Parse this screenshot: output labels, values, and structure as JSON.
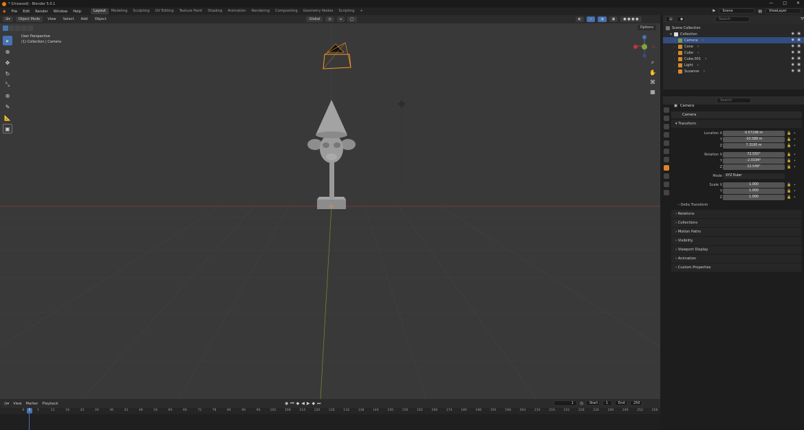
{
  "titlebar": {
    "title": "* (Unsaved) - Blender 5.0.1",
    "minimize": "—",
    "maximize": "□",
    "close": "✕"
  },
  "menu": [
    "File",
    "Edit",
    "Render",
    "Window",
    "Help"
  ],
  "workspaces": [
    "Layout",
    "Modeling",
    "Sculpting",
    "UV Editing",
    "Texture Paint",
    "Shading",
    "Animation",
    "Rendering",
    "Compositing",
    "Geometry Nodes",
    "Scripting"
  ],
  "workspace_add": "+",
  "scene": {
    "label": "Scene",
    "viewlayer": "ViewLayer"
  },
  "viewport_header": {
    "mode": "Object Mode",
    "view": "View",
    "select": "Select",
    "add": "Add",
    "object": "Object",
    "orientation": "Global",
    "options": "Options"
  },
  "viewport_info": {
    "perspective": "User Perspective",
    "context": "(1) Collection | Camera"
  },
  "timeline_header": {
    "view": "View",
    "marker": "Marker",
    "playback": "Playback",
    "current_frame": "1",
    "start_label": "Start",
    "start": "1",
    "end_label": "End",
    "end": "250"
  },
  "timeline_ticks": [
    "0",
    "1",
    "11",
    "18",
    "24",
    "30",
    "36",
    "42",
    "48",
    "54",
    "60",
    "66",
    "72",
    "78",
    "84",
    "90",
    "96",
    "102",
    "108",
    "114",
    "120",
    "126",
    "132",
    "138",
    "144",
    "150",
    "156",
    "162",
    "168",
    "174",
    "180",
    "186",
    "192",
    "198",
    "204",
    "210",
    "216",
    "222",
    "228",
    "234",
    "240",
    "246",
    "252",
    "258"
  ],
  "outliner": {
    "search_placeholder": "Search",
    "scene_collection": "Scene Collection",
    "collection": "Collection",
    "items": [
      {
        "name": "Camera",
        "color": "#7a9d4e"
      },
      {
        "name": "Cone",
        "color": "#d98a2b"
      },
      {
        "name": "Cube",
        "color": "#d98a2b"
      },
      {
        "name": "Cube.001",
        "color": "#d98a2b"
      },
      {
        "name": "Light",
        "color": "#d98a2b"
      },
      {
        "name": "Suzanne",
        "color": "#d98a2b"
      }
    ]
  },
  "properties": {
    "search_placeholder": "Search",
    "object": "Camera",
    "name": "Camera",
    "transform_label": "Transform",
    "location_label": "Location X",
    "rotation_label": "Rotation X",
    "mode_label": "Mode",
    "scale_label": "Scale X",
    "y_label": "Y",
    "z_label": "Z",
    "location": [
      "0.57198 m",
      "-10.588 m",
      "7.3195 m"
    ],
    "rotation": [
      "72.555°",
      "-2.0194°",
      "12.549°"
    ],
    "mode": "XYZ Euler",
    "scale": [
      "1.000",
      "1.000",
      "1.000"
    ],
    "delta": "Delta Transform",
    "panels": [
      "Relations",
      "Collections",
      "Motion Paths",
      "Visibility",
      "Viewport Display",
      "Animation",
      "Custom Properties"
    ]
  },
  "colors": {
    "accent": "#4772b3",
    "selected_outline": "#ff9a1f",
    "x_axis": "#c0393b",
    "y_axis": "#7fa53b"
  }
}
